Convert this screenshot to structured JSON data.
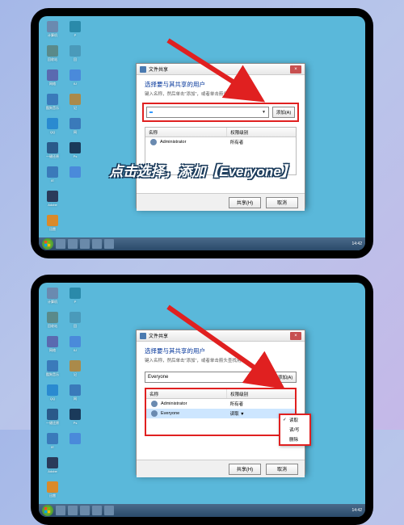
{
  "caption_top": "点击选择，添加【Everyone】",
  "desktop": {
    "icons_col1": [
      {
        "label": "计算机",
        "color": "#6a8ab0"
      },
      {
        "label": "回收站",
        "color": "#5a8a8a"
      },
      {
        "label": "网络",
        "color": "#5a6ab0"
      },
      {
        "label": "酷狗音乐",
        "color": "#3a7aba"
      },
      {
        "label": "QQ",
        "color": "#2a8ad0"
      },
      {
        "label": "一键还原",
        "color": "#2a5a8a"
      },
      {
        "label": "IE",
        "color": "#3a7aba"
      },
      {
        "label": "Adobe",
        "color": "#2a3a5a"
      },
      {
        "label": "迅雷",
        "color": "#da8a2a"
      }
    ],
    "icons_col2": [
      {
        "label": "P",
        "color": "#2a8aaa"
      },
      {
        "label": "回",
        "color": "#4a9aba"
      },
      {
        "label": "iU",
        "color": "#4a8ada"
      },
      {
        "label": "记",
        "color": "#aa8a4a"
      },
      {
        "label": "网",
        "color": "#3a7aba"
      },
      {
        "label": "Ps",
        "color": "#1a3a5a"
      },
      {
        "label": "",
        "color": "#4a8ada"
      }
    ],
    "tray_time": "14:42"
  },
  "dialog": {
    "title": "文件共享",
    "heading": "选择要与其共享的用户",
    "subtext": "键入名称，然后单击\"添加\"，或者单击箭头查找用户。",
    "combo_value_top": "",
    "combo_value_bottom": "Everyone",
    "add_btn": "添加(A)",
    "col_name": "名称",
    "col_perm": "权限级别",
    "user1": "Administrator",
    "user1_perm": "所有者",
    "user2": "Everyone",
    "user2_perm": "读取 ▼",
    "share_btn": "共享(H)",
    "cancel_btn": "取消"
  },
  "perm_menu": {
    "item1": "读取",
    "item2": "读/写",
    "item3": "删除"
  }
}
